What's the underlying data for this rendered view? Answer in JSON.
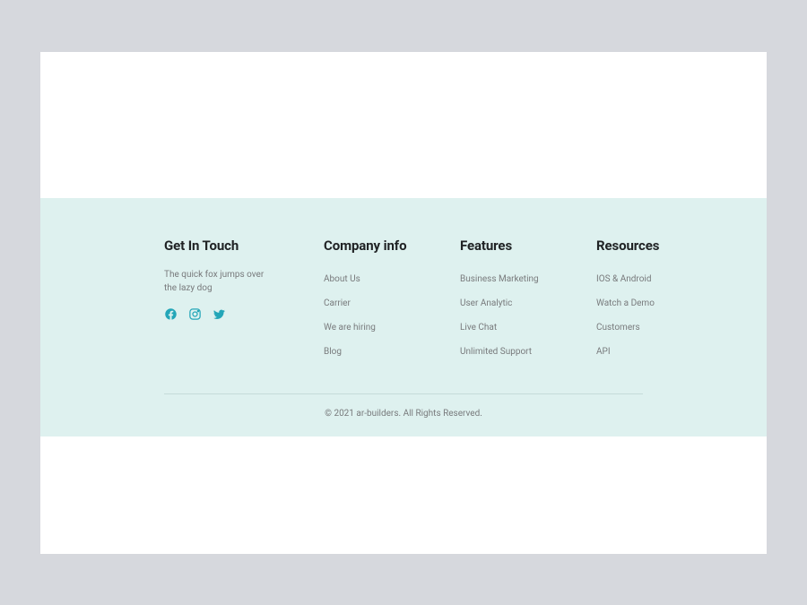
{
  "footer": {
    "getInTouch": {
      "title": "Get In Touch",
      "description": "The quick fox jumps over the lazy dog"
    },
    "columns": [
      {
        "title": "Company info",
        "links": [
          "About Us",
          "Carrier",
          "We are hiring",
          "Blog"
        ]
      },
      {
        "title": "Features",
        "links": [
          "Business Marketing",
          "User Analytic",
          "Live Chat",
          "Unlimited Support"
        ]
      },
      {
        "title": "Resources",
        "links": [
          "IOS & Android",
          "Watch a Demo",
          "Customers",
          "API"
        ]
      }
    ],
    "copyright": "© 2021 ar-builders. All Rights Reserved."
  }
}
